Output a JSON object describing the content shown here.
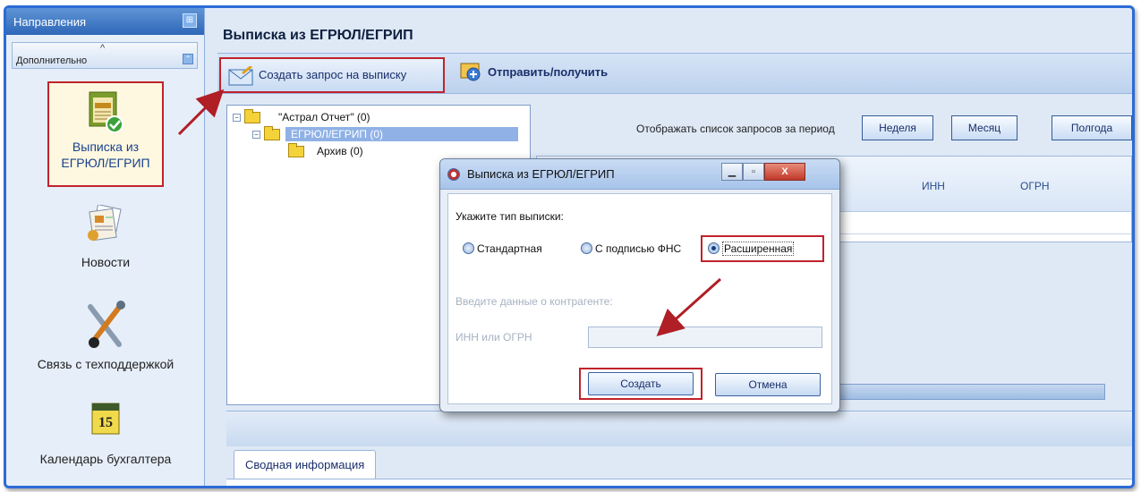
{
  "sidebar": {
    "header": "Направления",
    "group": "Дополнительно",
    "items": [
      {
        "label": "Выписка из ЕГРЮЛ/ЕГРИП"
      },
      {
        "label": "Новости"
      },
      {
        "label": "Связь с техподдержкой"
      },
      {
        "label": "Календарь бухгалтера"
      }
    ]
  },
  "main": {
    "title": "Выписка из ЕГРЮЛ/ЕГРИП",
    "toolbar": {
      "create_request": "Создать запрос на выписку",
      "send_receive": "Отправить/получить"
    },
    "tree": [
      {
        "label": "\"Астрал Отчет\" (0)"
      },
      {
        "label": "ЕГРЮЛ/ЕГРИП (0)"
      },
      {
        "label": "Архив (0)"
      }
    ],
    "period_label": "Отображать список запросов за период",
    "period_buttons": [
      "Неделя",
      "Месяц",
      "Полгода"
    ],
    "grid_columns": [
      "ИНН",
      "ОГРН"
    ],
    "bottom_tab": "Сводная информация"
  },
  "dialog": {
    "title": "Выписка из ЕГРЮЛ/ЕГРИП",
    "prompt": "Укажите тип выписки:",
    "options": [
      "Стандартная",
      "С подписью ФНС",
      "Расширенная"
    ],
    "selected": "Расширенная",
    "contractor_label": "Введите данные о контрагенте:",
    "inn_label": "ИНН или ОГРН",
    "inn_value": "",
    "create_button": "Создать",
    "cancel_button": "Отмена"
  },
  "colors": {
    "accent": "#2b6bd6",
    "highlight": "#c0232c",
    "selection": "#8fb1e6"
  }
}
